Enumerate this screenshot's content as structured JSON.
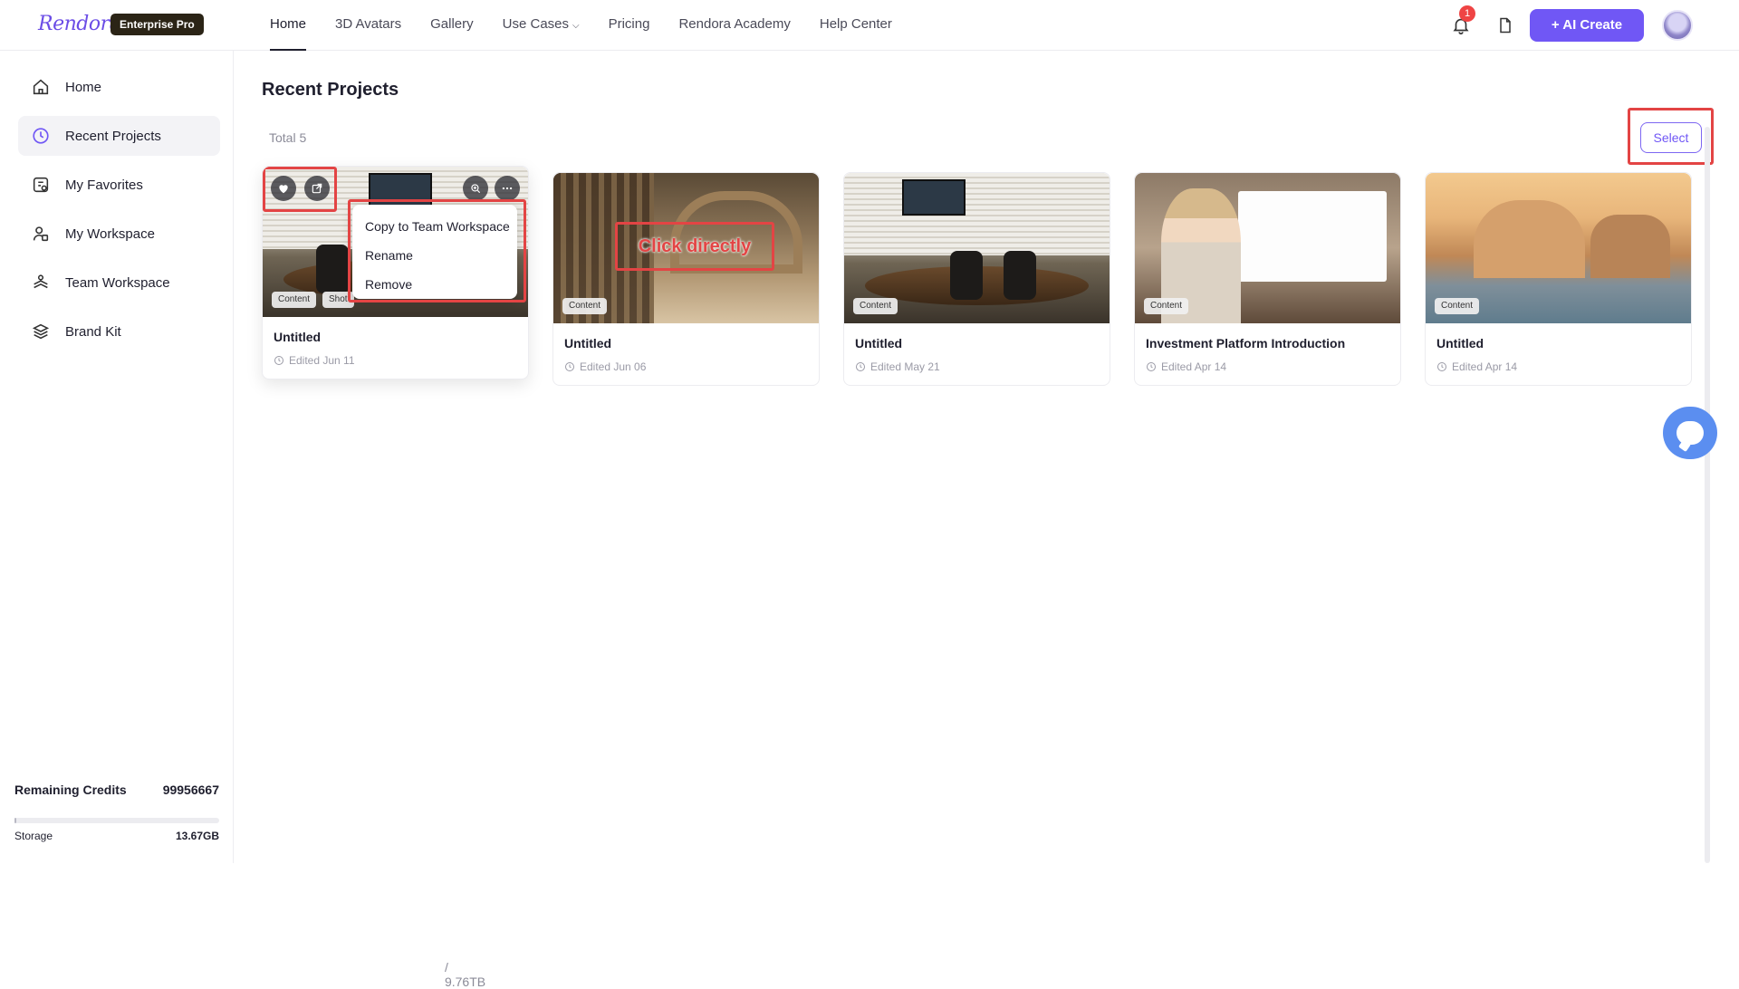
{
  "app": {
    "logo": "Rendora",
    "plan": "Enterprise Pro",
    "accent": "#7057f5"
  },
  "nav": {
    "items": [
      {
        "label": "Home",
        "active": true
      },
      {
        "label": "3D Avatars"
      },
      {
        "label": "Gallery"
      },
      {
        "label": "Use Cases",
        "has_dropdown": true
      },
      {
        "label": "Pricing"
      },
      {
        "label": "Rendora Academy"
      },
      {
        "label": "Help Center"
      }
    ],
    "notification_count": "1",
    "ai_create_label": "AI Create"
  },
  "sidebar": {
    "items": [
      {
        "label": "Home",
        "icon": "home-icon"
      },
      {
        "label": "Recent Projects",
        "icon": "clock-icon",
        "active": true
      },
      {
        "label": "My Favorites",
        "icon": "favorites-icon"
      },
      {
        "label": "My Workspace",
        "icon": "workspace-icon"
      },
      {
        "label": "Team Workspace",
        "icon": "team-icon"
      },
      {
        "label": "Brand Kit",
        "icon": "layers-icon"
      }
    ],
    "credits_label": "Remaining Credits",
    "credits_value": "99956667",
    "storage_label": "Storage",
    "storage_used": "13.67GB",
    "storage_total": " / 9.76TB",
    "storage_fraction": 0.0014
  },
  "main": {
    "title": "Recent Projects",
    "total": "Total 5",
    "select_label": "Select",
    "projects": [
      {
        "title": "Untitled",
        "edited": "Edited Jun 11",
        "tags": [
          "Content",
          "Shot"
        ]
      },
      {
        "title": "Untitled",
        "edited": "Edited Jun 06",
        "tags": [
          "Content"
        ]
      },
      {
        "title": "Untitled",
        "edited": "Edited May 21",
        "tags": [
          "Content"
        ]
      },
      {
        "title": "Investment Platform Introduction",
        "edited": "Edited Apr 14",
        "tags": [
          "Content"
        ]
      },
      {
        "title": "Untitled",
        "edited": "Edited Apr 14",
        "tags": [
          "Content"
        ]
      }
    ],
    "context_menu": [
      "Copy to Team Workspace",
      "Rename",
      "Remove"
    ],
    "annotation_text": "Click directly"
  }
}
